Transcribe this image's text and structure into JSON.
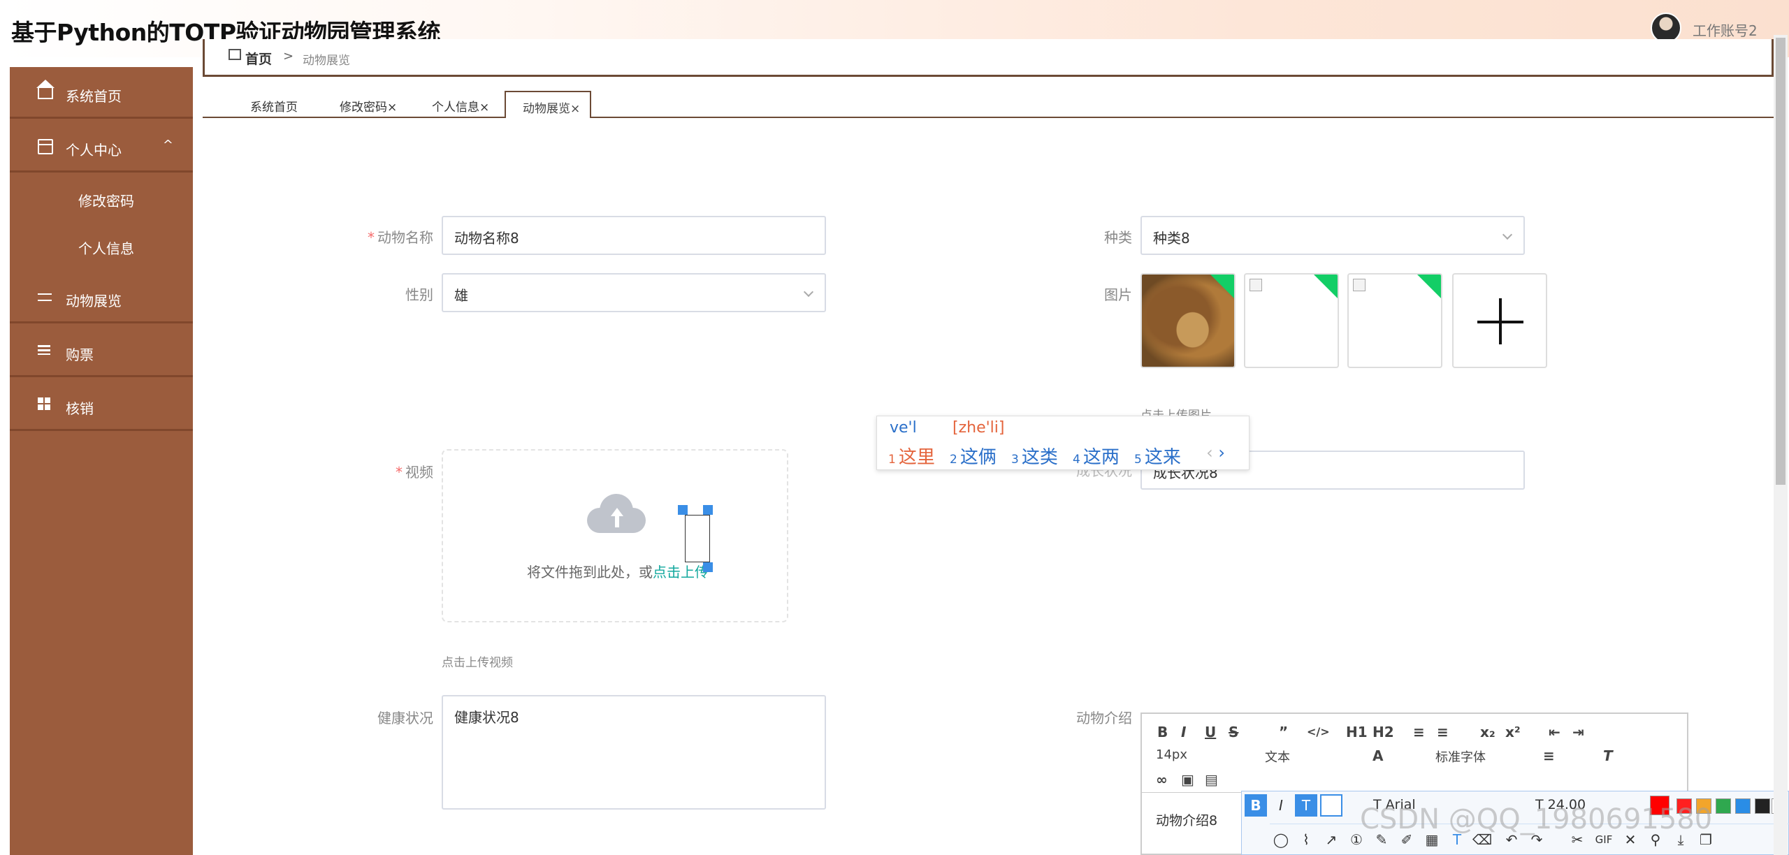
{
  "header": {
    "title": "基于Python的TOTP验证动物园管理系统",
    "user": "工作账号2"
  },
  "breadcrumb": {
    "home": "首页",
    "sep": ">",
    "current": "动物展览"
  },
  "sidebar": {
    "items": [
      {
        "label": "系统首页",
        "icon": "home-icon"
      },
      {
        "label": "个人中心",
        "icon": "user-card-icon",
        "expanded": true
      },
      {
        "label": "动物展览",
        "icon": "sliders-icon"
      },
      {
        "label": "购票",
        "icon": "list-icon"
      },
      {
        "label": "核销",
        "icon": "grid-icon"
      }
    ],
    "submenu": [
      "修改密码",
      "个人信息"
    ],
    "arrow": "^"
  },
  "tabs": [
    "系统首页",
    "修改密码×",
    "个人信息×",
    "动物展览×"
  ],
  "form": {
    "name_label": "动物名称",
    "name_value": "动物名称8",
    "category_label": "种类",
    "category_value": "种类8",
    "gender_label": "性别",
    "gender_value": "雄",
    "picture_label": "图片",
    "picture_hint": "点击上传图片",
    "video_label": "视频",
    "upload_text": "将文件拖到此处，或",
    "upload_link": "点击上传",
    "video_hint": "点击上传视频",
    "growth_label": "成长状况",
    "growth_value": "成长状况8",
    "health_label": "健康状况",
    "health_value": "健康状况8",
    "intro_label": "动物介绍",
    "intro_value": "动物介绍8",
    "required_mark": "*"
  },
  "ime": {
    "input": "ve'l",
    "pinyin": "[zhe'li]",
    "candidates": [
      "这里",
      "这俩",
      "这类",
      "这两",
      "这来"
    ],
    "nav_prev": "‹",
    "nav_next": "›"
  },
  "editor": {
    "row1": [
      "B",
      "I",
      "U",
      "S",
      "”",
      "</>",
      "H1",
      "H2",
      "≡",
      "≡",
      "x₂",
      "x²",
      "⇤",
      "⇥"
    ],
    "font_size": "14px",
    "text_type": "文本",
    "font_family": "标准字体"
  },
  "annotation": {
    "font": "Arial",
    "size": "24.00",
    "gif": "GIF",
    "colors": [
      "#ff0000",
      "#ff2020",
      "#f2a52b",
      "#2fa84f",
      "#2a8de6",
      "#222222",
      "#ffffff"
    ]
  },
  "watermark": "CSDN @QQ_1980691580"
}
